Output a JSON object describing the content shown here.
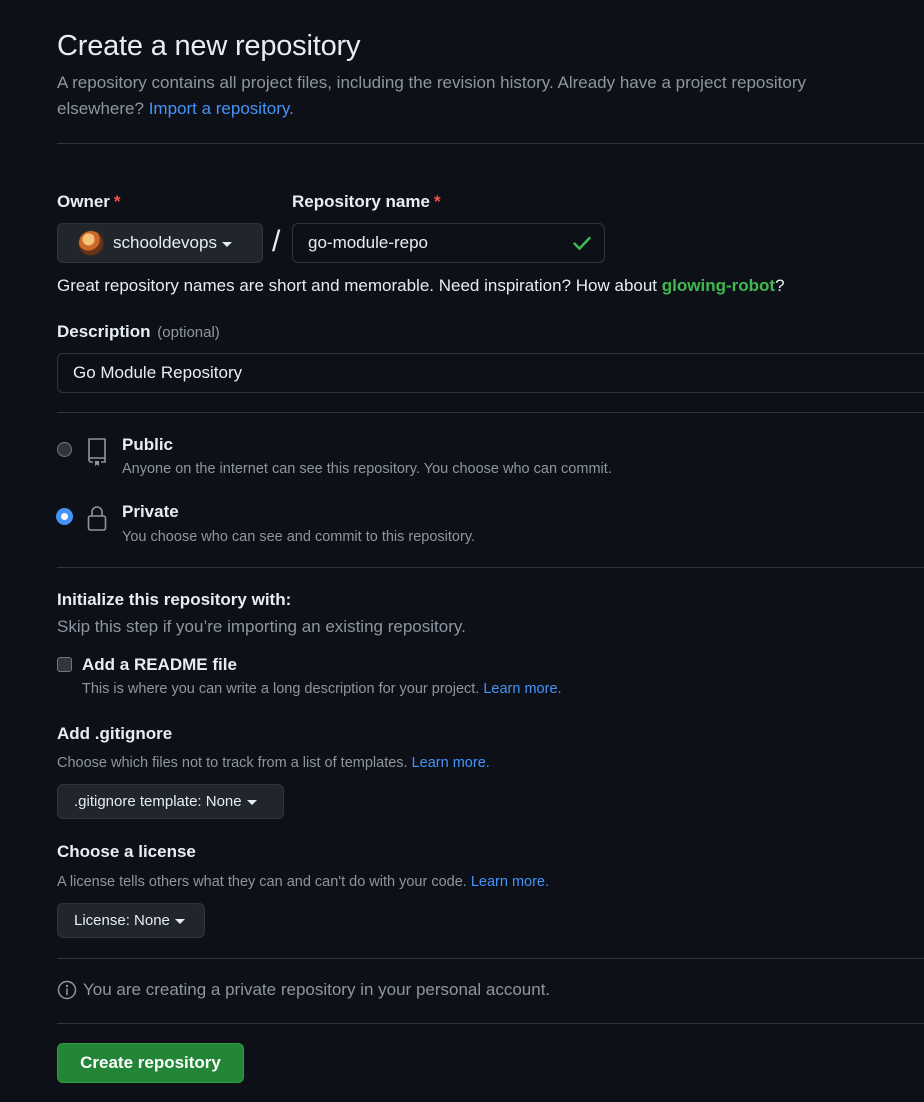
{
  "header": {
    "title": "Create a new repository",
    "subtitle": "A repository contains all project files, including the revision history. Already have a project repository elsewhere?",
    "import_link": "Import a repository."
  },
  "owner": {
    "label": "Owner",
    "required_mark": "*",
    "value": "schooldevops"
  },
  "separator": "/",
  "repo_name": {
    "label": "Repository name",
    "required_mark": "*",
    "value": "go-module-repo",
    "valid_icon": "check-icon"
  },
  "suggestion": {
    "text_before": "Great repository names are short and memorable. Need inspiration? How about",
    "name": "glowing-robot",
    "text_after": "?"
  },
  "description": {
    "label": "Description",
    "optional": "(optional)",
    "value": "Go Module Repository"
  },
  "visibility": {
    "selected": "Private",
    "options": [
      {
        "title": "Public",
        "desc": "Anyone on the internet can see this repository. You choose who can commit.",
        "icon": "repo-icon"
      },
      {
        "title": "Private",
        "desc": "You choose who can see and commit to this repository.",
        "icon": "lock-icon"
      }
    ]
  },
  "initialize": {
    "heading": "Initialize this repository with:",
    "subheading": "Skip this step if you’re importing an existing repository.",
    "readme": {
      "label": "Add a README file",
      "desc": "This is where you can write a long description for your project.",
      "link": "Learn more.",
      "checked": false
    }
  },
  "gitignore": {
    "label": "Add .gitignore",
    "desc": "Choose which files not to track from a list of templates.",
    "link": "Learn more.",
    "button": ".gitignore template: None"
  },
  "license": {
    "label": "Choose a license",
    "desc": "A license tells others what they can and can't do with your code.",
    "link": "Learn more.",
    "button": "License: None"
  },
  "info_text": "You are creating a private repository in your personal account.",
  "create_button": "Create repository",
  "colors": {
    "background": "#0d1117",
    "link": "#4493f8",
    "success": "#238636",
    "suggestion": "#3fb950",
    "required": "#f85149"
  }
}
